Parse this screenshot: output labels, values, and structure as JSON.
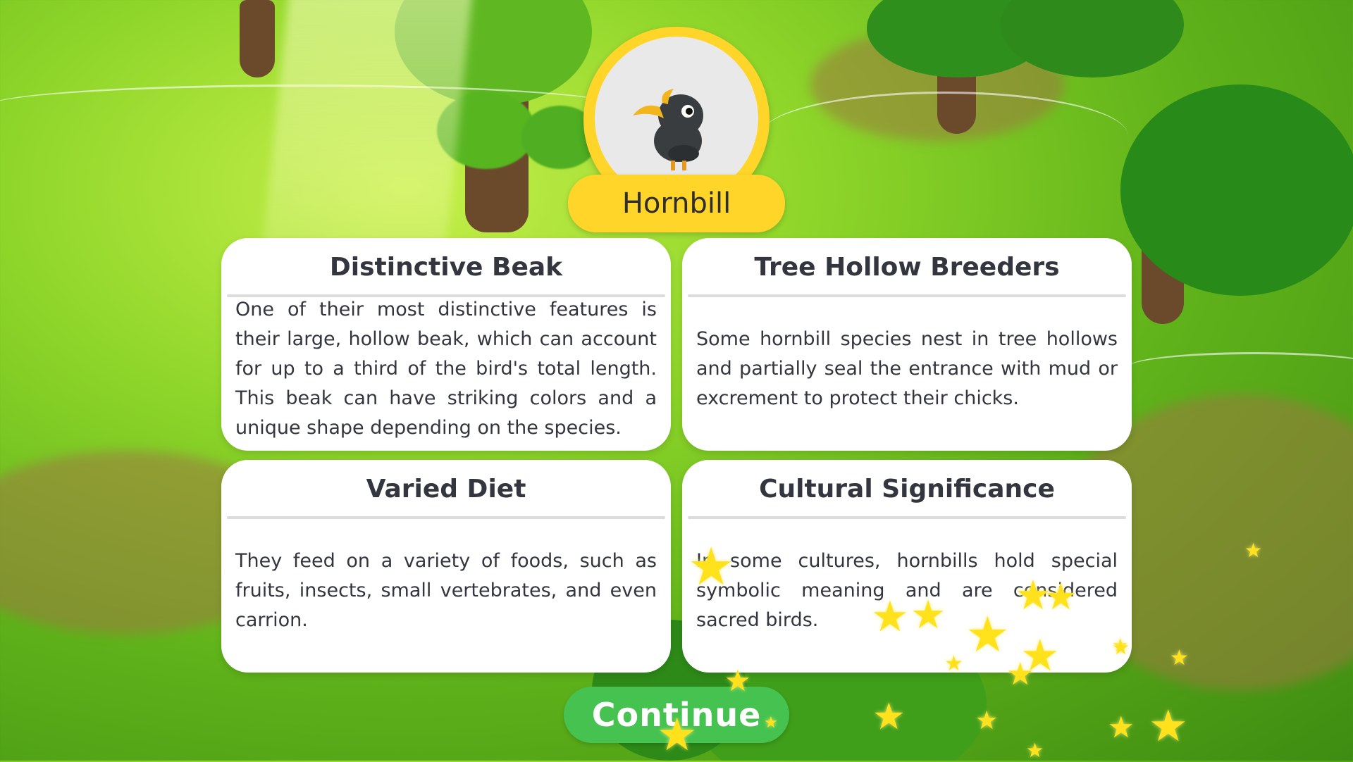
{
  "animal": {
    "name": "Hornbill",
    "icon": "hornbill-bird-icon"
  },
  "cards": [
    {
      "title": "Distinctive Beak",
      "text": "One of their most distinctive features is their large, hollow beak, which can account for up to a third of the bird's total length. This beak can have striking colors and a unique shape depending on the species."
    },
    {
      "title": "Tree Hollow Breeders",
      "text": "Some hornbill species nest in tree hollows and partially seal the entrance with mud or excrement to protect their chicks."
    },
    {
      "title": "Varied Diet",
      "text": "They feed on a variety of foods, such as fruits, insects, small vertebrates, and even carrion."
    },
    {
      "title": "Cultural Significance",
      "text": "In some cultures, hornbills hold special symbolic meaning and are considered sacred birds."
    }
  ],
  "continue_label": "Continue",
  "colors": {
    "badge": "#ffd52a",
    "button": "#45c24f",
    "card": "#ffffff",
    "text": "#33363f",
    "star": "#ffe11c"
  }
}
